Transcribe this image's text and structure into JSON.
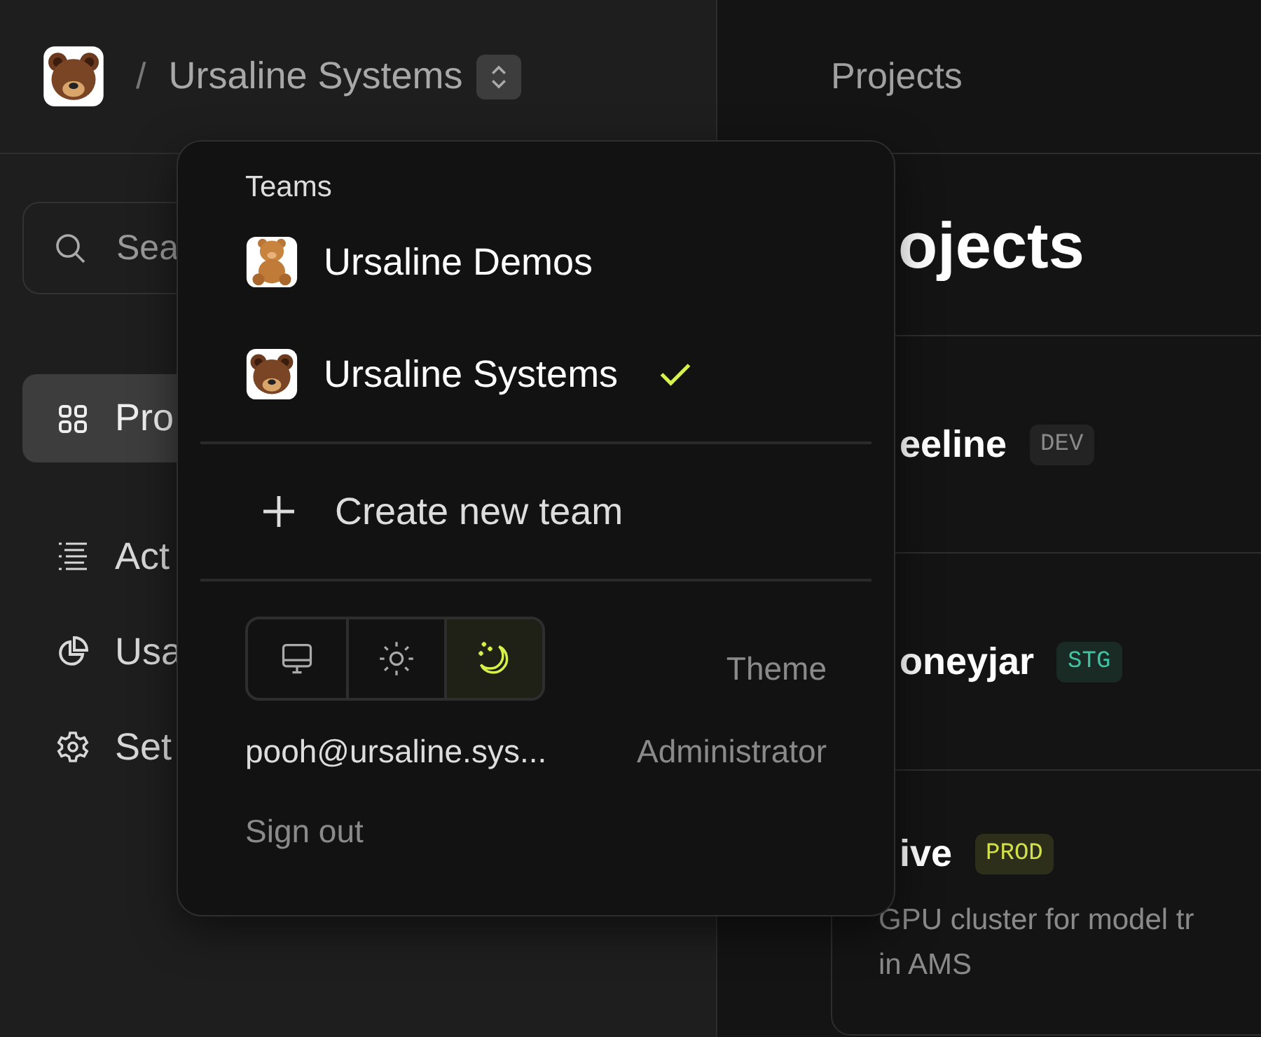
{
  "header": {
    "separator": "/",
    "team": "Ursaline Systems"
  },
  "search": {
    "placeholder": "Sea"
  },
  "sidebar": {
    "items": [
      {
        "label": "Pro",
        "selected": true
      },
      {
        "label": "Act",
        "selected": false
      },
      {
        "label": "Usa",
        "selected": false
      },
      {
        "label": "Set",
        "selected": false
      }
    ]
  },
  "main": {
    "breadcrumb": "Projects",
    "heading": "ojects",
    "projects": [
      {
        "name": "eeline",
        "tag": "DEV",
        "color": "#8a8a8a"
      },
      {
        "name": "oneyjar",
        "tag": "STG",
        "color": "#3fc3a0"
      },
      {
        "name": "ive",
        "tag": "PROD",
        "color": "#d2e04a",
        "description": [
          "GPU cluster for model tr",
          "in AMS"
        ]
      }
    ]
  },
  "menu": {
    "title": "Teams",
    "teams": [
      {
        "name": "Ursaline Demos",
        "selected": false
      },
      {
        "name": "Ursaline Systems",
        "selected": true
      }
    ],
    "create": "Create new team",
    "theme": {
      "label": "Theme",
      "options": [
        {
          "selected": false
        },
        {
          "selected": false
        },
        {
          "selected": true
        }
      ]
    },
    "account": {
      "email": "pooh@ursaline.sys...",
      "role": "Administrator"
    },
    "sign_out": "Sign out"
  }
}
